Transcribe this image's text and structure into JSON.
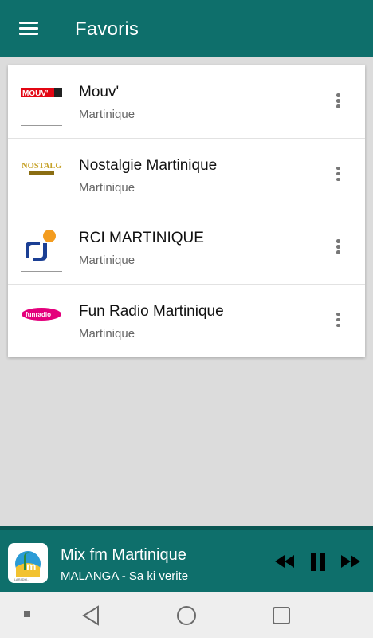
{
  "appbar": {
    "title": "Favoris",
    "menu_icon": "hamburger-menu-icon"
  },
  "stations": [
    {
      "name": "Mouv'",
      "region": "Martinique",
      "logo_text": "MOUV'",
      "logo_color": "#e30613"
    },
    {
      "name": "Nostalgie Martinique",
      "region": "Martinique",
      "logo_text": "NOSTALGIE",
      "logo_color": "#c7a32b"
    },
    {
      "name": "RCI MARTINIQUE",
      "region": "Martinique",
      "logo_text": "rci",
      "logo_color": "#1b3f94",
      "logo_accent": "#f39c1f"
    },
    {
      "name": "Fun Radio Martinique",
      "region": "Martinique",
      "logo_text": "funradio",
      "logo_color": "#e4007c"
    }
  ],
  "now_playing": {
    "station": "Mix fm Martinique",
    "track": "MALANGA - Sa ki verite",
    "logo_text": "m"
  },
  "colors": {
    "primary": "#0e6f6b",
    "background": "#dcdcdc"
  }
}
